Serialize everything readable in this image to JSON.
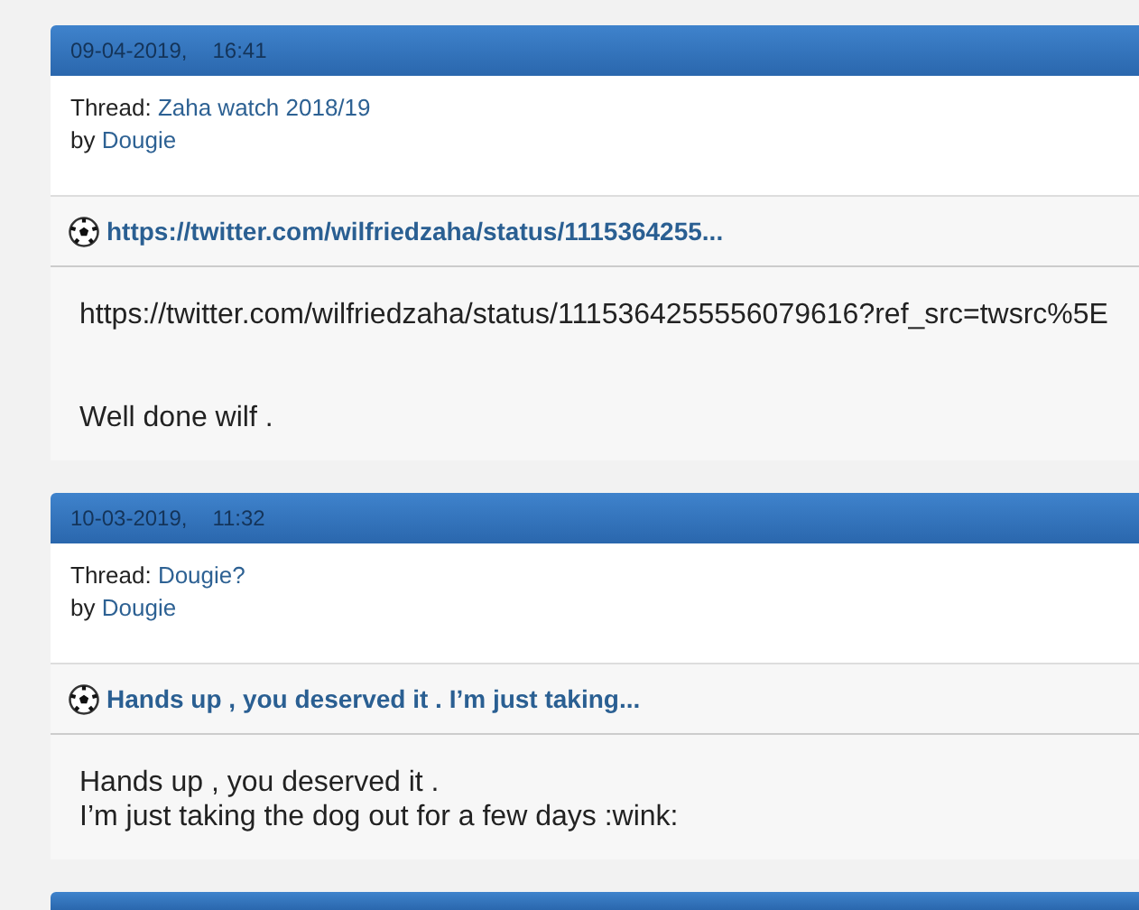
{
  "posts": [
    {
      "date": "09-04-2019,",
      "time": "16:41",
      "thread_label": "Thread:",
      "thread": "Zaha watch 2018/19",
      "by_label": "by",
      "author": "Dougie",
      "title": "https://twitter.com/wilfriedzaha/status/1115364255...",
      "body": [
        [
          "https://twitter.com/wilfriedzaha/status/1115364255556079616?ref_src=twsrc%5E"
        ],
        [
          "Well done wilf ."
        ]
      ]
    },
    {
      "date": "10-03-2019,",
      "time": "11:32",
      "thread_label": "Thread:",
      "thread": "Dougie?",
      "by_label": "by",
      "author": "Dougie",
      "title": "Hands up , you deserved it . I’m just taking...",
      "body": [
        [
          "Hands up , you deserved it .",
          "I’m just taking the dog out for a few days :wink:"
        ]
      ]
    }
  ]
}
